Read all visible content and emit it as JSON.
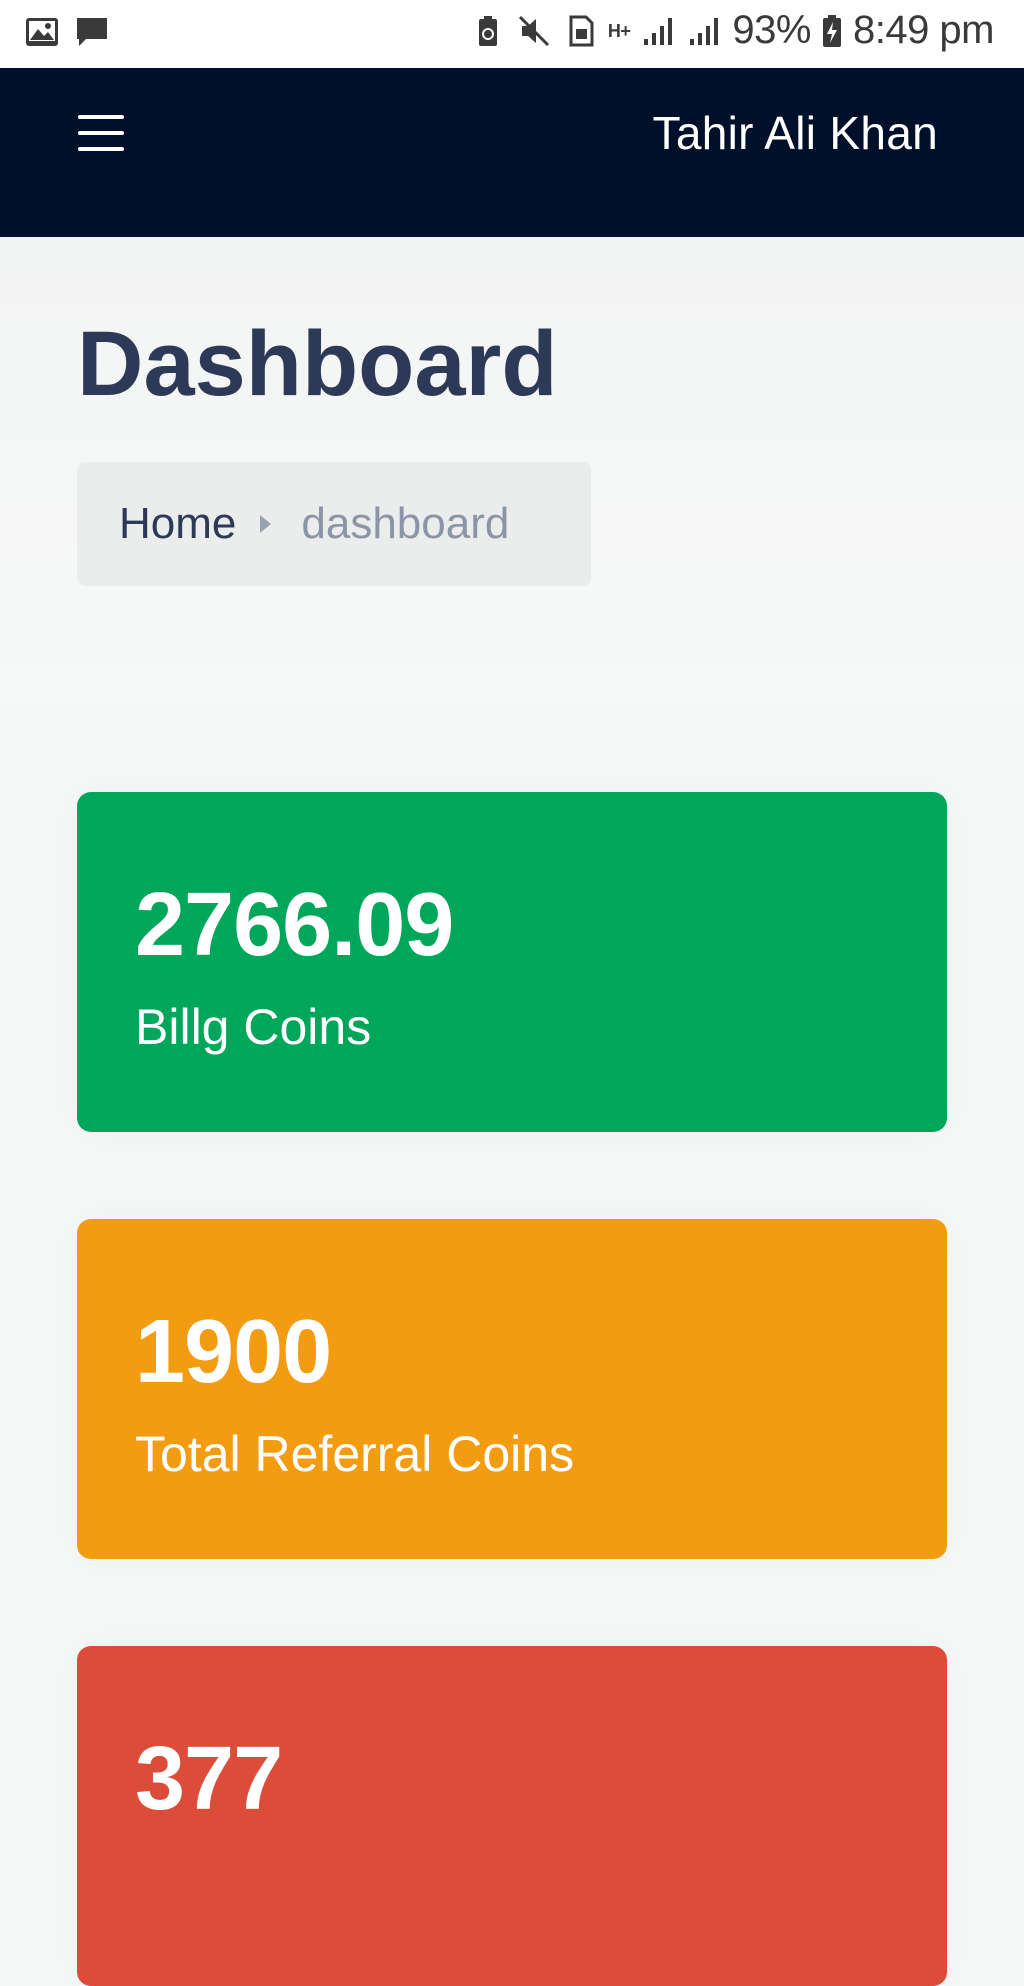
{
  "status_bar": {
    "battery": "93%",
    "time": "8:49 pm",
    "network": "H+",
    "icons": [
      "gallery-icon",
      "message-icon",
      "battery-saver-icon",
      "mute-icon",
      "sim-icon",
      "signal-icon",
      "signal-icon",
      "battery-icon"
    ]
  },
  "navbar": {
    "user_name": "Tahir Ali Khan",
    "background": "#00102a",
    "menu_icon": "hamburger-menu-icon"
  },
  "page": {
    "title": "Dashboard"
  },
  "breadcrumb": {
    "home": "Home",
    "current": "dashboard",
    "separator_icon": "chevron-right-icon"
  },
  "cards": [
    {
      "value": "2766.09",
      "label": "Billg Coins",
      "color": "#00a65a"
    },
    {
      "value": "1900",
      "label": "Total Referral Coins",
      "color": "#f39c12"
    },
    {
      "value": "377",
      "label": "",
      "color": "#dd4b39"
    }
  ]
}
